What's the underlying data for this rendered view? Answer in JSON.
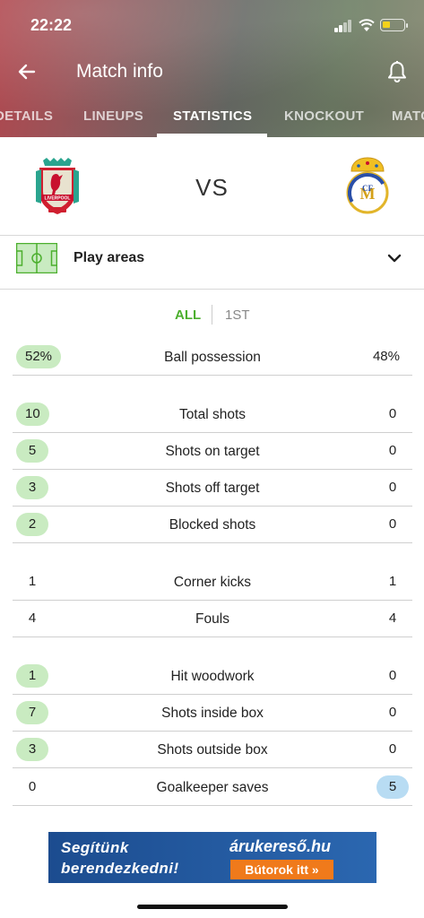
{
  "status_bar": {
    "time": "22:22"
  },
  "header": {
    "title": "Match info",
    "tabs": [
      {
        "label": "DETAILS"
      },
      {
        "label": "LINEUPS"
      },
      {
        "label": "STATISTICS"
      },
      {
        "label": "KNOCKOUT"
      },
      {
        "label": "MATC"
      }
    ],
    "active_tab": "STATISTICS"
  },
  "match": {
    "vs_label": "VS",
    "home_crest": "liverpool-crest-icon",
    "away_crest": "real-madrid-crest-icon"
  },
  "section": {
    "label": "Play areas",
    "icon": "pitch-icon"
  },
  "period_filter": {
    "all_label": "ALL",
    "first_label": "1ST",
    "selected": "ALL"
  },
  "colors": {
    "accent_green": "#4caf2e",
    "home_highlight": "#c9ebc1",
    "away_highlight": "#b8dcf3",
    "ad_orange": "#f07a1b"
  },
  "stats": {
    "possession": {
      "label": "Ball possession",
      "home": "52%",
      "away": "48%"
    },
    "total_shots": {
      "label": "Total shots",
      "home": "10",
      "away": "0"
    },
    "shots_on_target": {
      "label": "Shots on target",
      "home": "5",
      "away": "0"
    },
    "shots_off_target": {
      "label": "Shots off target",
      "home": "3",
      "away": "0"
    },
    "blocked_shots": {
      "label": "Blocked shots",
      "home": "2",
      "away": "0"
    },
    "corner_kicks": {
      "label": "Corner kicks",
      "home": "1",
      "away": "1"
    },
    "fouls": {
      "label": "Fouls",
      "home": "4",
      "away": "4"
    },
    "hit_woodwork": {
      "label": "Hit woodwork",
      "home": "1",
      "away": "0"
    },
    "shots_inside_box": {
      "label": "Shots inside box",
      "home": "7",
      "away": "0"
    },
    "shots_outside_box": {
      "label": "Shots outside box",
      "home": "3",
      "away": "0"
    },
    "goalkeeper_saves": {
      "label": "Goalkeeper saves",
      "home": "0",
      "away": "5"
    }
  },
  "ad": {
    "line1": "Segítünk",
    "line2": "berendezkedni!",
    "brand": "árukereső.hu",
    "cta": "Bútorok itt »",
    "close": "✕"
  }
}
